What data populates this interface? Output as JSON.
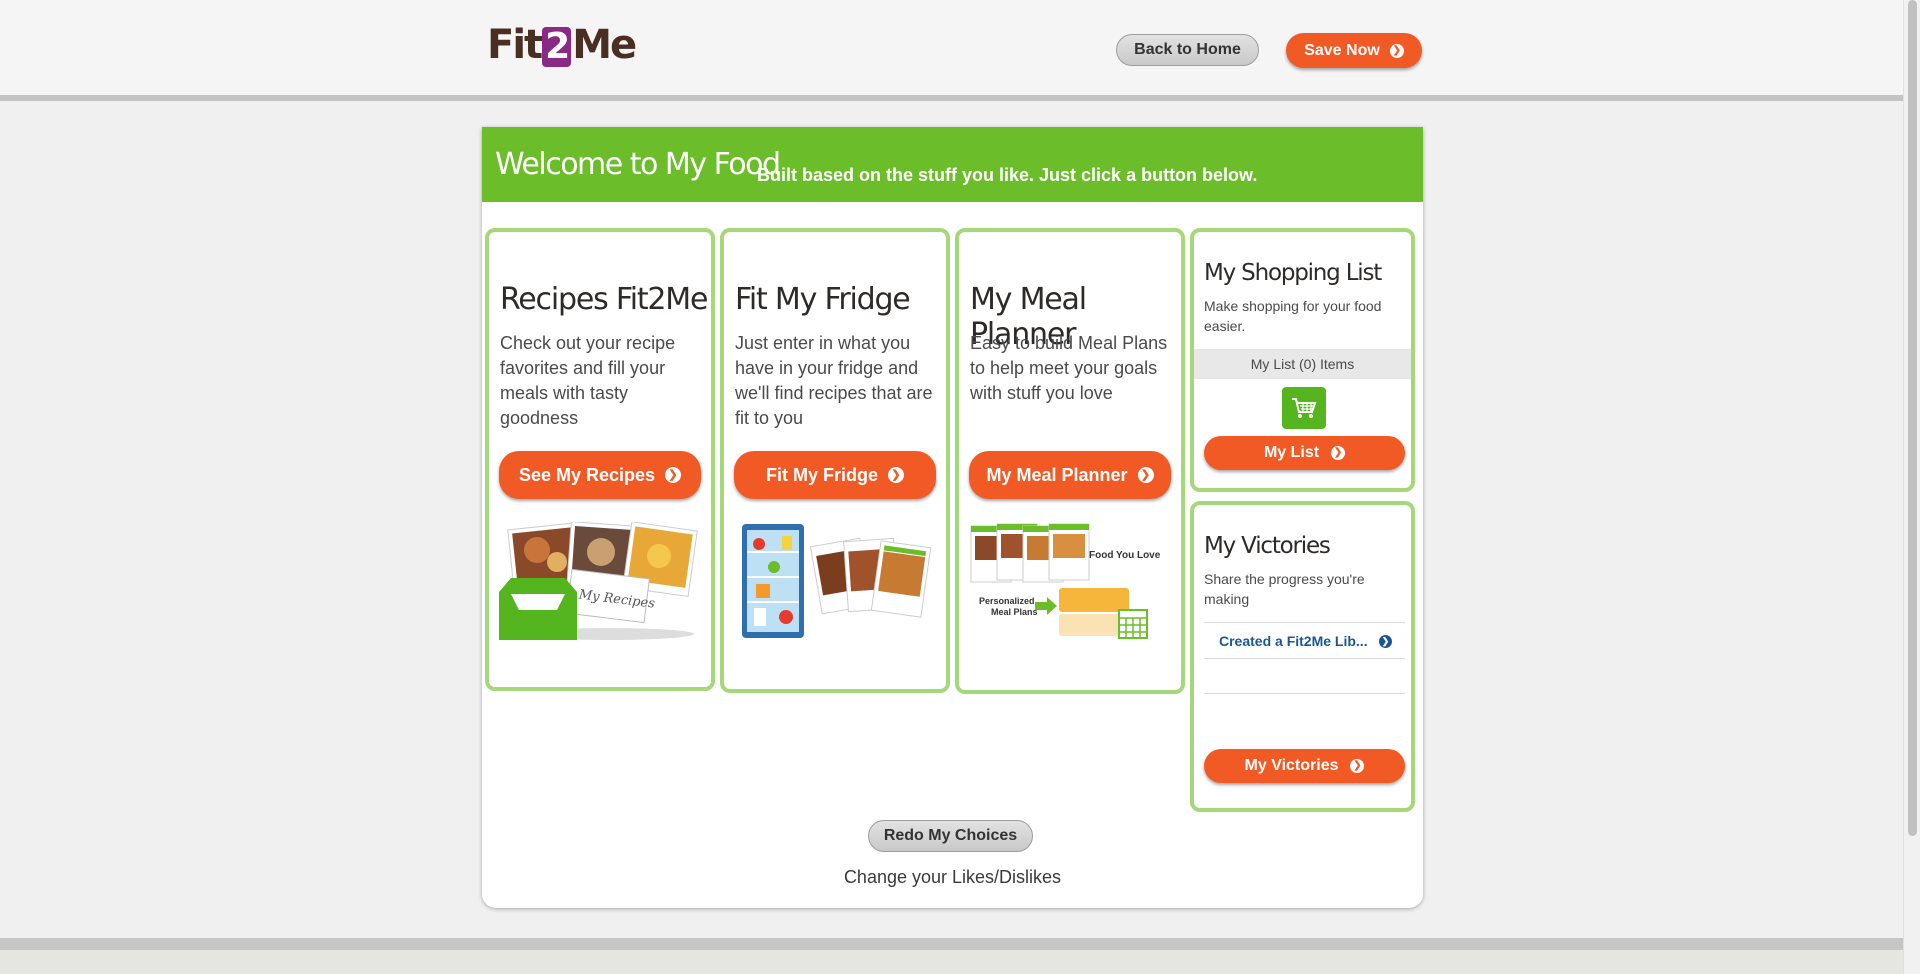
{
  "header": {
    "logo": {
      "part1": "Fit",
      "part2": "2",
      "part3": "Me"
    },
    "back_home": "Back to Home",
    "save_now": "Save Now"
  },
  "banner": {
    "title": "Welcome to My Food",
    "subtitle": "Built based on the stuff you like. Just click a button below."
  },
  "cards": [
    {
      "title": "Recipes Fit2Me",
      "desc": "Check out your recipe favorites and fill your meals with tasty goodness",
      "button": "See My Recipes",
      "art_label": "My Recipes"
    },
    {
      "title": "Fit My Fridge",
      "desc": "Just enter in what you have in your fridge and we'll find recipes that are fit to you",
      "button": "Fit My Fridge"
    },
    {
      "title": "My Meal Planner",
      "desc": "Easy to build Meal Plans to help meet your goals with stuff you love",
      "button": "My Meal Planner",
      "art_label_1": "Food You Love",
      "art_label_2": "Personalized",
      "art_label_3": "Meal Plans"
    }
  ],
  "shopping": {
    "title": "My Shopping List",
    "desc": "Make shopping for your food easier.",
    "list_status": "My List (0) Items",
    "button": "My List"
  },
  "victories": {
    "title": "My Victories",
    "desc": "Share the progress you're making",
    "items": [
      "Created a Fit2Me Lib..."
    ],
    "button": "My Victories"
  },
  "footer": {
    "redo": "Redo My Choices",
    "change": "Change your Likes/Dislikes"
  },
  "colors": {
    "brand_green": "#6cbd2a",
    "accent_orange": "#f15a24",
    "card_border": "#a5d87b",
    "link_blue": "#1a5790"
  },
  "icons": [
    "arrow-circle-right-icon",
    "shopping-cart-icon"
  ]
}
